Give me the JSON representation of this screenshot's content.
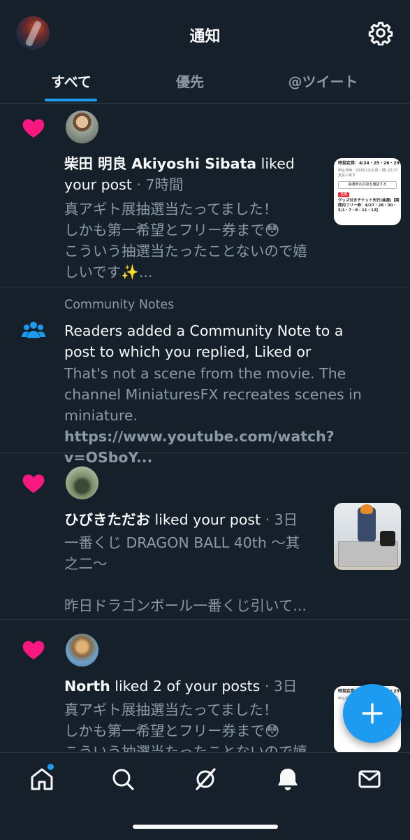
{
  "header": {
    "title": "通知"
  },
  "tabs": [
    {
      "label": "すべて",
      "active": true
    },
    {
      "label": "優先",
      "active": false
    },
    {
      "label": "@ツイート",
      "active": false
    }
  ],
  "notifications": [
    {
      "type": "like",
      "user": "柴田 明良 Akiyoshi Sibata",
      "action_line1": " liked",
      "action_line2": "your post",
      "time": " · 7時間",
      "text_lines": [
        "真アギト展抽選当たってました！",
        "しかも第一希望とフリー券まで😳",
        "こういう抽選当たったことないので嬉",
        "しいです✨..."
      ],
      "thumb": {
        "line1": "時指定券：4/24・25・26・29",
        "line2": "申込日時：2026/1/12(月・祝) 22:37",
        "line3": "支払いあり",
        "button": "抽選申込内容を確認する",
        "tag": "当選",
        "line4": "グッズ付きチケット先行(抽選)【期",
        "line5": "間内フリー券：4/27・28・30・",
        "line6": "5/1・7・8・11・12】"
      }
    },
    {
      "type": "community",
      "category": "Community Notes",
      "head_lines": [
        "Readers added a Community Note to a",
        "post to which you replied, Liked or"
      ],
      "text_lines": [
        "That's not a scene from the movie. The",
        "channel MiniaturesFX recreates scenes in",
        "miniature."
      ],
      "link": "https://www.youtube.com/watch?v=OSboY..."
    },
    {
      "type": "like",
      "user": "ひびきただお",
      "action_line1": " liked your post",
      "time": " · 3日",
      "text_lines": [
        "一番くじ DRAGON BALL 40th 〜其",
        "之二〜",
        "",
        "昨日ドラゴンボール一番くじ引いて..."
      ]
    },
    {
      "type": "like",
      "user": "North",
      "action_line1": " liked 2 of your posts",
      "time": " · 3日",
      "text_lines": [
        "真アギト展抽選当たってました！",
        "しかも第一希望とフリー券まで😳",
        "こういう抽選当たったことないので嬉"
      ]
    }
  ],
  "colors": {
    "accent": "#1d9bf0",
    "like": "#f91880",
    "background": "#15202b",
    "secondary_text": "#8b98a5"
  },
  "bottom_nav": [
    "home-icon",
    "search-icon",
    "grok-icon",
    "notifications-bell-icon",
    "messages-envelope-icon"
  ]
}
